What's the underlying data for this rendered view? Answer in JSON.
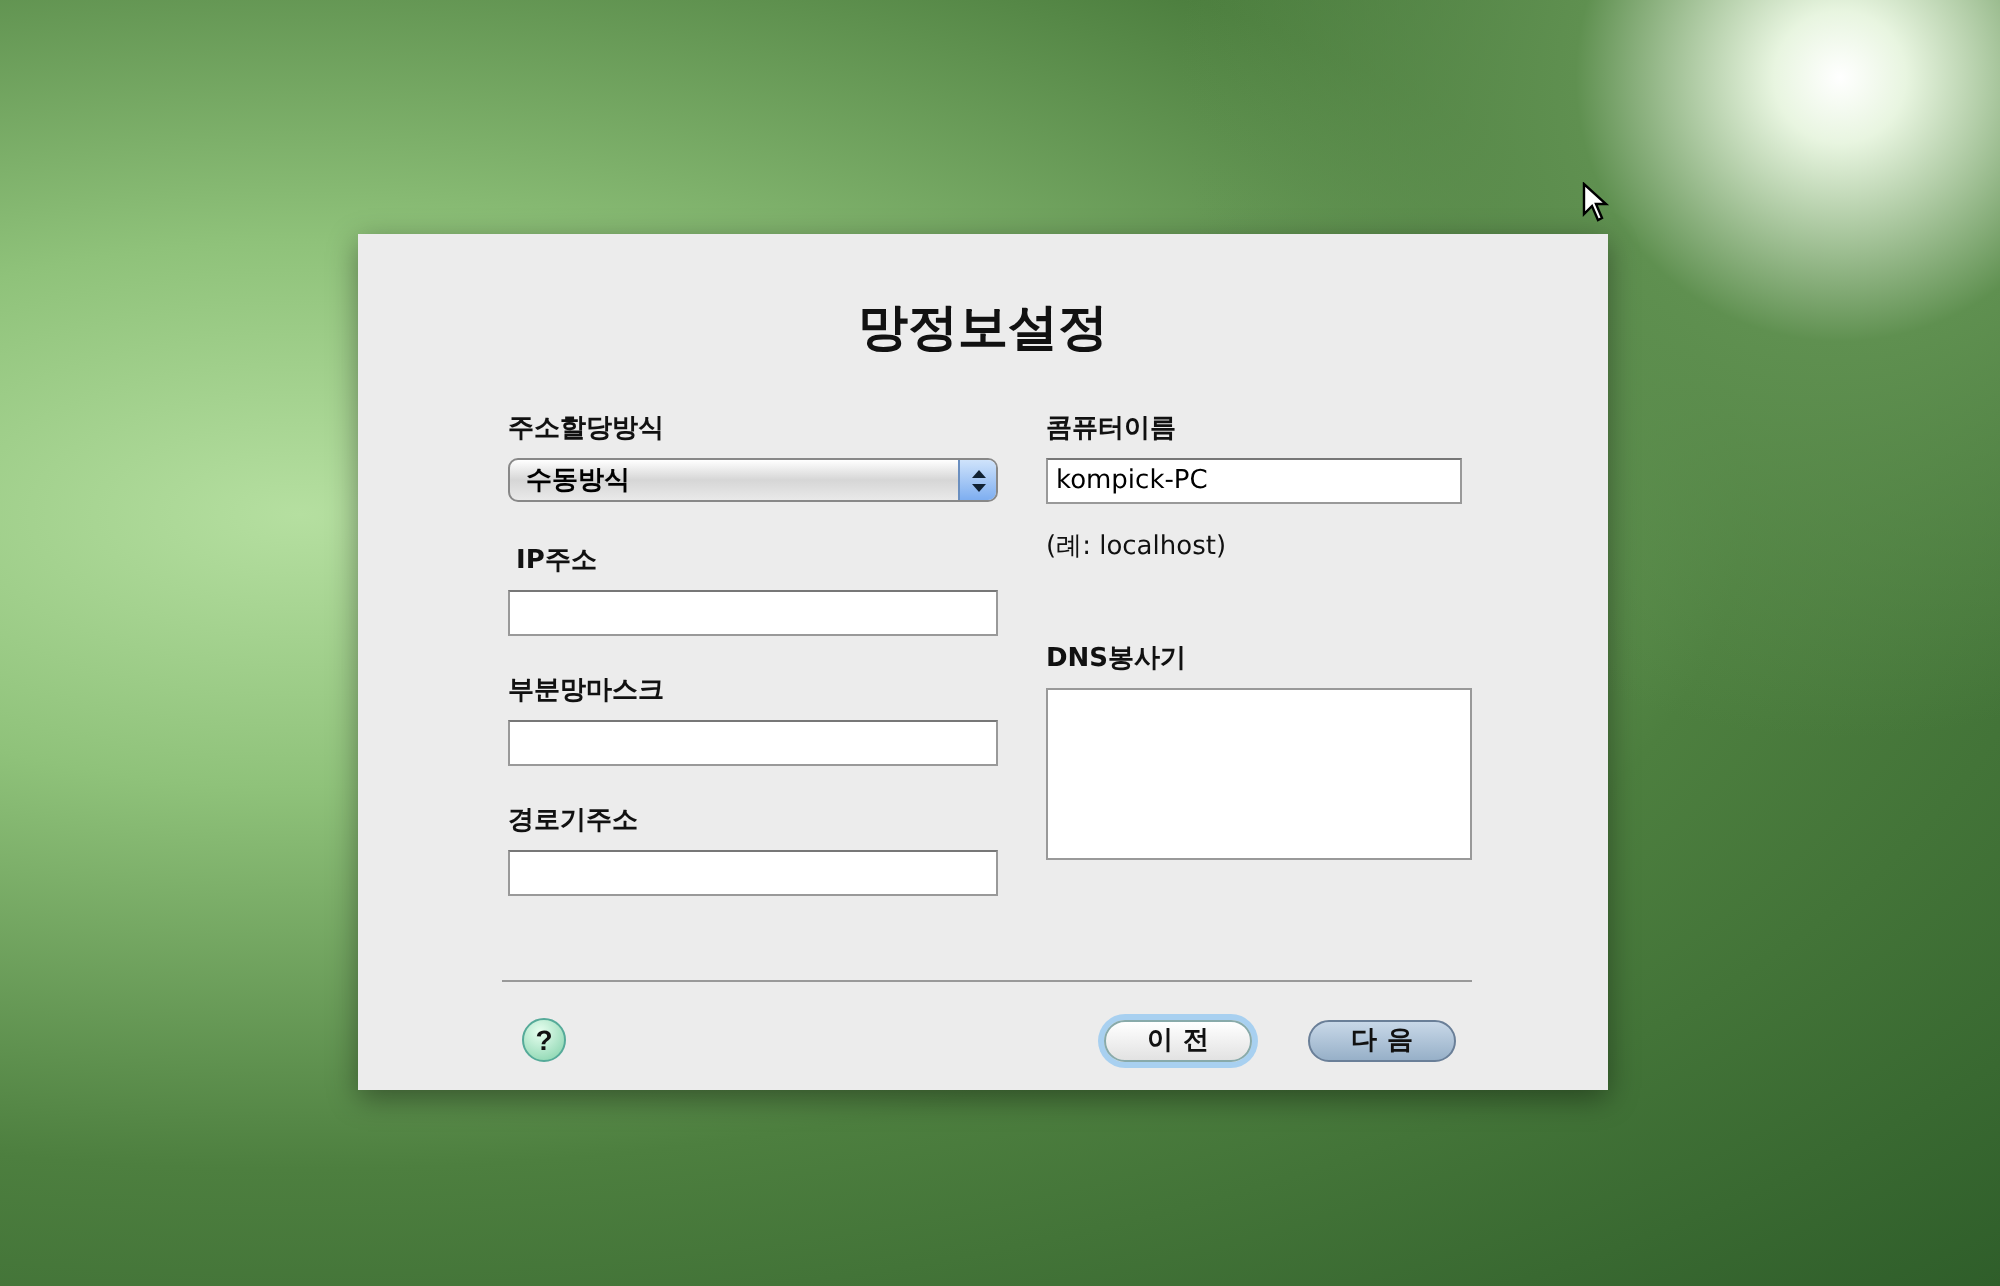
{
  "dialog": {
    "title": "망정보설정",
    "left_fields": [
      {
        "kind": "select",
        "label": "주소할당방식",
        "value": "수동방식"
      },
      {
        "kind": "text",
        "label": "IP주소"
      },
      {
        "kind": "text",
        "label": "부분망마스크"
      },
      {
        "kind": "text",
        "label": "경로기주소"
      }
    ],
    "computer_name": {
      "label": "콤퓨터이름",
      "value": "kompick-PC",
      "hint": "(례: localhost)"
    },
    "dns": {
      "label": "DNS봉사기"
    },
    "help": "?",
    "buttons": [
      {
        "label": "이 전",
        "focused": true
      },
      {
        "label": "다 음",
        "focused": false
      }
    ]
  }
}
